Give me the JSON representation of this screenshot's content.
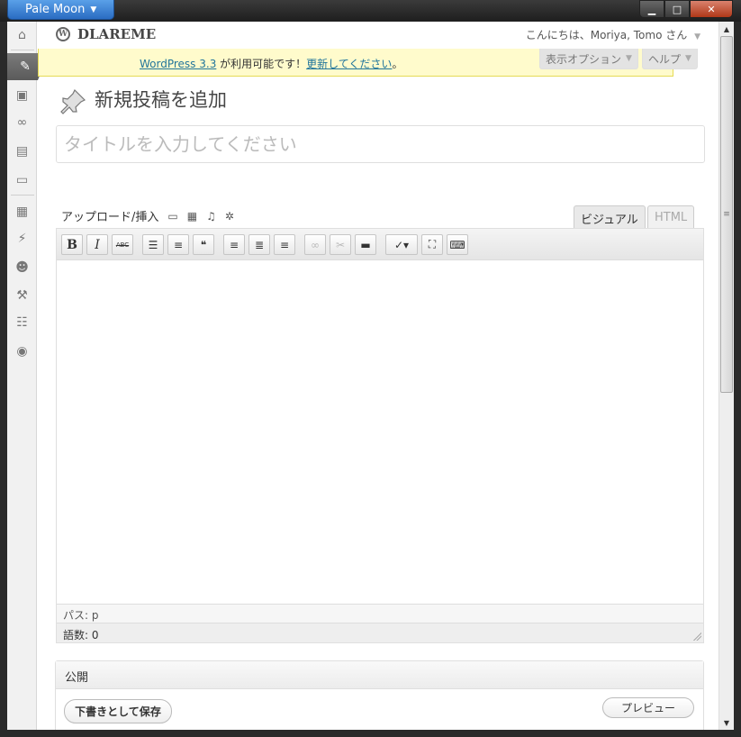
{
  "window": {
    "app_menu_label": "Pale Moon",
    "minimize_label": "▁",
    "maximize_label": "□",
    "close_label": "✕"
  },
  "header": {
    "site_name": "DLAREME",
    "howdy": "こんにちは、Moriya, Tomo さん"
  },
  "update_nag": {
    "link_version": "WordPress 3.3",
    "middle_text": " が利用可能です！",
    "link_update": "更新してください",
    "end_text": "。"
  },
  "screen_tabs": {
    "screen_options": "表示オプション",
    "help": "ヘルプ"
  },
  "page": {
    "title": "新規投稿を追加",
    "title_placeholder": "タイトルを入力してください"
  },
  "editor": {
    "upload_label": "アップロード/挿入",
    "tab_visual": "ビジュアル",
    "tab_html": "HTML",
    "path_text": "パス: p",
    "word_count": "語数: 0"
  },
  "publish": {
    "heading": "公開",
    "save_draft": "下書きとして保存",
    "preview": "プレビュー"
  },
  "admin_menu": {
    "icons": [
      "dashboard-icon",
      "posts-icon",
      "media-icon",
      "links-icon",
      "pages-icon",
      "comments-icon",
      "appearance-icon",
      "plugins-icon",
      "users-icon",
      "tools-icon",
      "settings-icon",
      "collapse-icon"
    ]
  },
  "toolbar_buttons": [
    "bold",
    "italic",
    "strikethrough",
    "bulleted-list",
    "numbered-list",
    "blockquote",
    "align-left",
    "align-center",
    "align-right",
    "insert-link",
    "remove-link",
    "insert-more",
    "spellcheck",
    "fullscreen",
    "kitchen-sink"
  ],
  "colors": {
    "link": "#21759b",
    "nag_background": "#fffbcc",
    "nag_border": "#e6db55",
    "active_menu": "#6d6d6d"
  }
}
